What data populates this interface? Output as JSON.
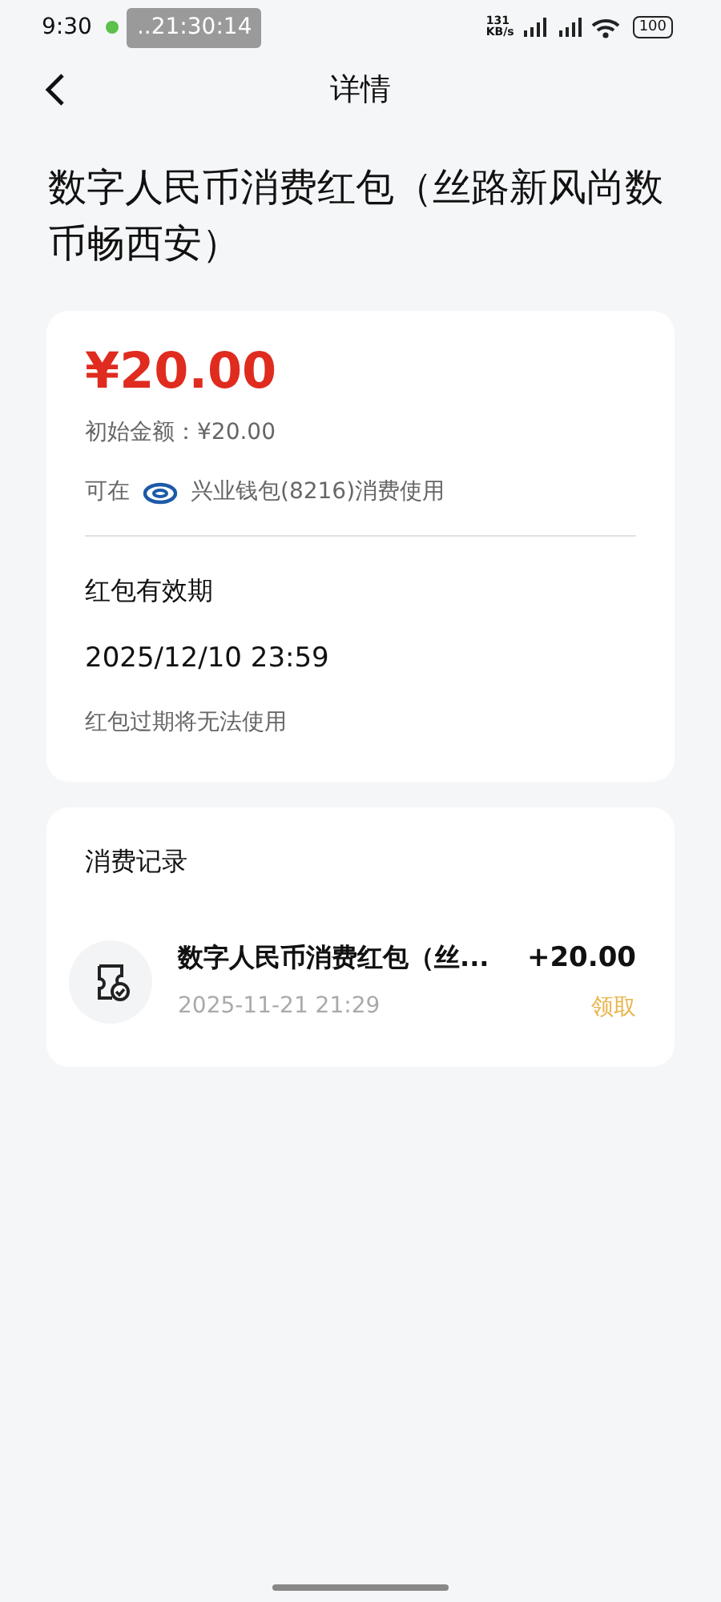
{
  "status_bar": {
    "time": "9:30",
    "recorder_time": "..21:30:14",
    "net_speed": "131\nKB/s",
    "battery": "100"
  },
  "nav": {
    "title": "详情"
  },
  "heading": "数字人民币消费红包（丝路新风尚数币畅西安）",
  "summary_card": {
    "amount": "¥20.00",
    "initial_amount": "初始金额：¥20.00",
    "usable_prefix": "可在",
    "wallet": "兴业钱包(8216)消费使用",
    "validity_label": "红包有效期",
    "validity_date": "2025/12/10 23:59",
    "expiry_note": "红包过期将无法使用"
  },
  "records_card": {
    "title": "消费记录",
    "records": [
      {
        "name": "数字人民币消费红包（丝...",
        "time": "2025-11-21 21:29",
        "amount": "+20.00",
        "type": "领取"
      }
    ]
  }
}
